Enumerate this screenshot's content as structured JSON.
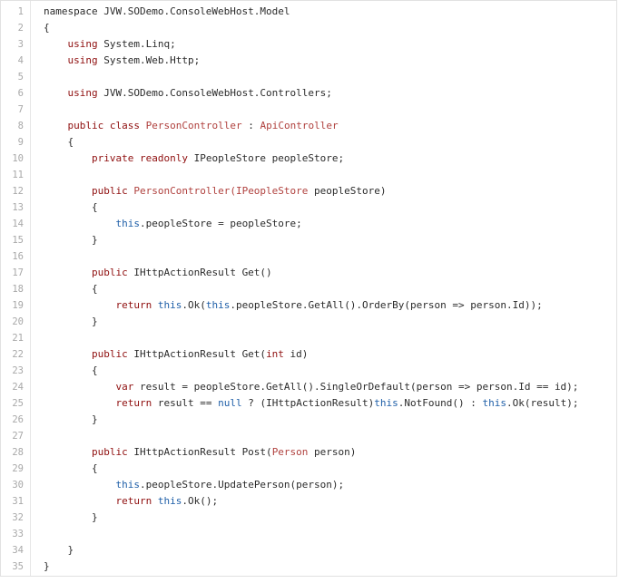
{
  "editor": {
    "lines": [
      {
        "n": "1",
        "tokens": [
          {
            "t": "namespace JVW.SODemo.ConsoleWebHost.Model",
            "c": ""
          }
        ]
      },
      {
        "n": "2",
        "tokens": [
          {
            "t": "{",
            "c": ""
          }
        ]
      },
      {
        "n": "3",
        "tokens": [
          {
            "t": "    ",
            "c": ""
          },
          {
            "t": "using",
            "c": "kw"
          },
          {
            "t": " System.Linq;",
            "c": ""
          }
        ]
      },
      {
        "n": "4",
        "tokens": [
          {
            "t": "    ",
            "c": ""
          },
          {
            "t": "using",
            "c": "kw"
          },
          {
            "t": " System.Web.Http;",
            "c": ""
          }
        ]
      },
      {
        "n": "5",
        "tokens": []
      },
      {
        "n": "6",
        "tokens": [
          {
            "t": "    ",
            "c": ""
          },
          {
            "t": "using",
            "c": "kw"
          },
          {
            "t": " JVW.SODemo.ConsoleWebHost.Controllers;",
            "c": ""
          }
        ]
      },
      {
        "n": "7",
        "tokens": []
      },
      {
        "n": "8",
        "tokens": [
          {
            "t": "    ",
            "c": ""
          },
          {
            "t": "public",
            "c": "kw"
          },
          {
            "t": " ",
            "c": ""
          },
          {
            "t": "class",
            "c": "kw"
          },
          {
            "t": " ",
            "c": ""
          },
          {
            "t": "PersonController",
            "c": "type"
          },
          {
            "t": " : ",
            "c": ""
          },
          {
            "t": "ApiController",
            "c": "type"
          }
        ]
      },
      {
        "n": "9",
        "tokens": [
          {
            "t": "    {",
            "c": ""
          }
        ]
      },
      {
        "n": "10",
        "tokens": [
          {
            "t": "        ",
            "c": ""
          },
          {
            "t": "private",
            "c": "kw"
          },
          {
            "t": " ",
            "c": ""
          },
          {
            "t": "readonly",
            "c": "kw"
          },
          {
            "t": " IPeopleStore peopleStore;",
            "c": ""
          }
        ]
      },
      {
        "n": "11",
        "tokens": []
      },
      {
        "n": "12",
        "tokens": [
          {
            "t": "        ",
            "c": ""
          },
          {
            "t": "public",
            "c": "kw"
          },
          {
            "t": " ",
            "c": ""
          },
          {
            "t": "PersonController(IPeopleStore",
            "c": "type"
          },
          {
            "t": " peopleStore)",
            "c": ""
          }
        ]
      },
      {
        "n": "13",
        "tokens": [
          {
            "t": "        {",
            "c": ""
          }
        ]
      },
      {
        "n": "14",
        "tokens": [
          {
            "t": "            ",
            "c": ""
          },
          {
            "t": "this",
            "c": "kw2"
          },
          {
            "t": ".peopleStore = peopleStore;",
            "c": ""
          }
        ]
      },
      {
        "n": "15",
        "tokens": [
          {
            "t": "        }",
            "c": ""
          }
        ]
      },
      {
        "n": "16",
        "tokens": []
      },
      {
        "n": "17",
        "tokens": [
          {
            "t": "        ",
            "c": ""
          },
          {
            "t": "public",
            "c": "kw"
          },
          {
            "t": " IHttpActionResult Get()",
            "c": ""
          }
        ]
      },
      {
        "n": "18",
        "tokens": [
          {
            "t": "        {",
            "c": ""
          }
        ]
      },
      {
        "n": "19",
        "tokens": [
          {
            "t": "            ",
            "c": ""
          },
          {
            "t": "return",
            "c": "kw"
          },
          {
            "t": " ",
            "c": ""
          },
          {
            "t": "this",
            "c": "kw2"
          },
          {
            "t": ".Ok(",
            "c": ""
          },
          {
            "t": "this",
            "c": "kw2"
          },
          {
            "t": ".peopleStore.GetAll().OrderBy(person => person.Id));",
            "c": ""
          }
        ]
      },
      {
        "n": "20",
        "tokens": [
          {
            "t": "        }",
            "c": ""
          }
        ]
      },
      {
        "n": "21",
        "tokens": []
      },
      {
        "n": "22",
        "tokens": [
          {
            "t": "        ",
            "c": ""
          },
          {
            "t": "public",
            "c": "kw"
          },
          {
            "t": " IHttpActionResult Get(",
            "c": ""
          },
          {
            "t": "int",
            "c": "kw"
          },
          {
            "t": " id)",
            "c": ""
          }
        ]
      },
      {
        "n": "23",
        "tokens": [
          {
            "t": "        {",
            "c": ""
          }
        ]
      },
      {
        "n": "24",
        "tokens": [
          {
            "t": "            ",
            "c": ""
          },
          {
            "t": "var",
            "c": "kw"
          },
          {
            "t": " result = peopleStore.GetAll().SingleOrDefault(person => person.Id == id);",
            "c": ""
          }
        ]
      },
      {
        "n": "25",
        "tokens": [
          {
            "t": "            ",
            "c": ""
          },
          {
            "t": "return",
            "c": "kw"
          },
          {
            "t": " result == ",
            "c": ""
          },
          {
            "t": "null",
            "c": "kw2"
          },
          {
            "t": " ? (IHttpActionResult)",
            "c": ""
          },
          {
            "t": "this",
            "c": "kw2"
          },
          {
            "t": ".NotFound() : ",
            "c": ""
          },
          {
            "t": "this",
            "c": "kw2"
          },
          {
            "t": ".Ok(result);",
            "c": ""
          }
        ]
      },
      {
        "n": "26",
        "tokens": [
          {
            "t": "        }",
            "c": ""
          }
        ]
      },
      {
        "n": "27",
        "tokens": []
      },
      {
        "n": "28",
        "tokens": [
          {
            "t": "        ",
            "c": ""
          },
          {
            "t": "public",
            "c": "kw"
          },
          {
            "t": " IHttpActionResult Post(",
            "c": ""
          },
          {
            "t": "Person",
            "c": "type"
          },
          {
            "t": " person)",
            "c": ""
          }
        ]
      },
      {
        "n": "29",
        "tokens": [
          {
            "t": "        {",
            "c": ""
          }
        ]
      },
      {
        "n": "30",
        "tokens": [
          {
            "t": "            ",
            "c": ""
          },
          {
            "t": "this",
            "c": "kw2"
          },
          {
            "t": ".peopleStore.UpdatePerson(person);",
            "c": ""
          }
        ]
      },
      {
        "n": "31",
        "tokens": [
          {
            "t": "            ",
            "c": ""
          },
          {
            "t": "return",
            "c": "kw"
          },
          {
            "t": " ",
            "c": ""
          },
          {
            "t": "this",
            "c": "kw2"
          },
          {
            "t": ".Ok();",
            "c": ""
          }
        ]
      },
      {
        "n": "32",
        "tokens": [
          {
            "t": "        }",
            "c": ""
          }
        ]
      },
      {
        "n": "33",
        "tokens": []
      },
      {
        "n": "34",
        "tokens": [
          {
            "t": "    }",
            "c": ""
          }
        ]
      },
      {
        "n": "35",
        "tokens": [
          {
            "t": "}",
            "c": ""
          }
        ]
      }
    ]
  }
}
